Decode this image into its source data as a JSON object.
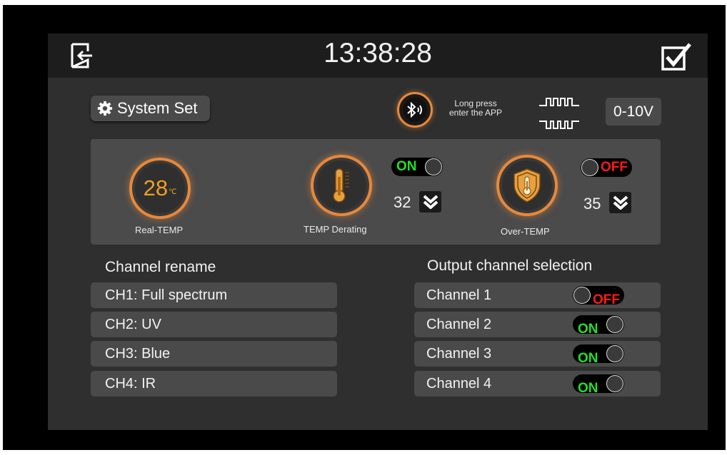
{
  "header": {
    "time": "13:38:28"
  },
  "system": {
    "label": "System Set"
  },
  "bluetooth": {
    "hint_line1": "Long press",
    "hint_line2": "enter the APP"
  },
  "output_mode": {
    "label": "0-10V"
  },
  "temperature": {
    "real": {
      "value": "28",
      "unit": "℃",
      "caption": "Real-TEMP"
    },
    "derating": {
      "caption": "TEMP Derating",
      "toggle": "ON",
      "setpoint": "32"
    },
    "over": {
      "caption": "Over-TEMP",
      "toggle": "OFF",
      "setpoint": "35"
    }
  },
  "channel_rename": {
    "title": "Channel rename",
    "items": [
      "CH1: Full spectrum",
      "CH2: UV",
      "CH3: Blue",
      "CH4: IR"
    ]
  },
  "output_selection": {
    "title": "Output channel selection",
    "channels": [
      {
        "label": "Channel 1",
        "state": "OFF"
      },
      {
        "label": "Channel 2",
        "state": "ON"
      },
      {
        "label": "Channel 3",
        "state": "ON"
      },
      {
        "label": "Channel 4",
        "state": "ON"
      }
    ]
  },
  "colors": {
    "accent": "#e8883a",
    "on": "#22e02a",
    "off": "#ff1a1a",
    "temp_value": "#f0a020"
  },
  "icons": [
    "exit-icon",
    "checkbox-icon",
    "gear-icon",
    "bluetooth-icon",
    "waveform-icon",
    "thermometer-icon",
    "shield-thermometer-icon",
    "chevron-down-icon"
  ]
}
